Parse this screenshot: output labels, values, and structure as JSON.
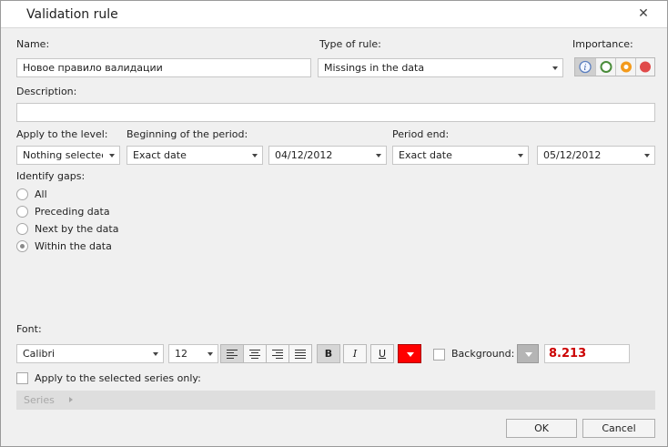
{
  "window": {
    "title": "Validation rule"
  },
  "fields": {
    "name_label": "Name:",
    "name_value": "Новое правило валидации",
    "type_label": "Type of rule:",
    "type_value": "Missings in the data",
    "importance_label": "Importance:",
    "description_label": "Description:",
    "description_value": "",
    "level_label": "Apply to the level:",
    "level_value": "Nothing selected",
    "begin_label": "Beginning of the period:",
    "begin_mode": "Exact date",
    "begin_date": "04/12/2012",
    "end_label": "Period end:",
    "end_mode": "Exact date",
    "end_date": "05/12/2012"
  },
  "gaps": {
    "label": "Identify gaps:",
    "options": [
      "All",
      "Preceding data",
      "Next by the data",
      "Within the data"
    ],
    "selected": "Within the data"
  },
  "font": {
    "label": "Font:",
    "family": "Calibri",
    "size": "12",
    "bold_label": "B",
    "italic_label": "I",
    "underline_label": "U",
    "text_color": "#ff0000",
    "background_label": "Background:",
    "preview": "8.213",
    "preview_color": "#cc0000"
  },
  "series": {
    "apply_label": "Apply to the selected series only:",
    "breadcrumb": "Series"
  },
  "buttons": {
    "ok": "OK",
    "cancel": "Cancel"
  },
  "importance": {
    "info_color": "#5b7fbf",
    "low_color": "#4a8c3a",
    "medium_color": "#f39a1c",
    "high_color": "#e04a4a"
  }
}
